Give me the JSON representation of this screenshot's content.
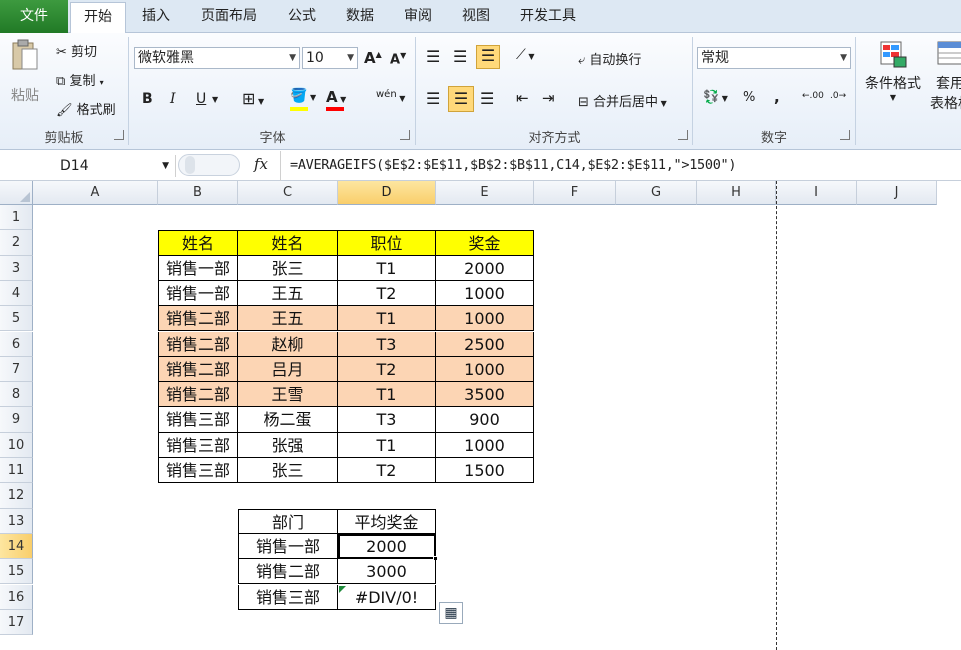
{
  "tabs": [
    "文件",
    "开始",
    "插入",
    "页面布局",
    "公式",
    "数据",
    "审阅",
    "视图",
    "开发工具"
  ],
  "ribbon": {
    "clipboard": {
      "paste": "粘贴",
      "cut": "剪切",
      "copy": "复制",
      "format_painter": "格式刷",
      "label": "剪贴板"
    },
    "font": {
      "name": "微软雅黑",
      "size": "10",
      "label": "字体",
      "bold": "B",
      "italic": "I",
      "underline": "U",
      "grow": "A",
      "shrink": "A",
      "fill_color": "#ffff00",
      "font_color": "#ff0000",
      "phonetic": "wén"
    },
    "align": {
      "wrap": "自动换行",
      "merge": "合并后居中",
      "label": "对齐方式"
    },
    "number": {
      "format": "常规",
      "label": "数字",
      "percent": "%",
      "comma": ",",
      "inc": ".00",
      "dec": ".0"
    },
    "styles": {
      "cond": "条件格式",
      "table": "套用",
      "table2": "表格格"
    }
  },
  "formula_bar": {
    "name_box": "D14",
    "fx": "fx",
    "formula": "=AVERAGEIFS($E$2:$E$11,$B$2:$B$11,C14,$E$2:$E$11,\">1500\")"
  },
  "columns": [
    "A",
    "B",
    "C",
    "D",
    "E",
    "F",
    "G",
    "H",
    "I",
    "J"
  ],
  "rows": [
    "1",
    "2",
    "3",
    "4",
    "5",
    "6",
    "7",
    "8",
    "9",
    "10",
    "11",
    "12",
    "13",
    "14",
    "15",
    "16",
    "17"
  ],
  "selected": {
    "col": "D",
    "row": "14"
  },
  "table1": {
    "header": [
      "姓名",
      "姓名",
      "职位",
      "奖金"
    ],
    "rows": [
      [
        "销售一部",
        "张三",
        "T1",
        "2000"
      ],
      [
        "销售一部",
        "王五",
        "T2",
        "1000"
      ],
      [
        "销售二部",
        "王五",
        "T1",
        "1000"
      ],
      [
        "销售二部",
        "赵柳",
        "T3",
        "2500"
      ],
      [
        "销售二部",
        "吕月",
        "T2",
        "1000"
      ],
      [
        "销售二部",
        "王雪",
        "T1",
        "3500"
      ],
      [
        "销售三部",
        "杨二蛋",
        "T3",
        "900"
      ],
      [
        "销售三部",
        "张强",
        "T1",
        "1000"
      ],
      [
        "销售三部",
        "张三",
        "T2",
        "1500"
      ]
    ],
    "header_color": "#ffff00",
    "highlight_color": "#fcd5b4"
  },
  "table2": {
    "header": [
      "部门",
      "平均奖金"
    ],
    "rows": [
      [
        "销售一部",
        "2000"
      ],
      [
        "销售二部",
        "3000"
      ],
      [
        "销售三部",
        "#DIV/0!"
      ]
    ]
  }
}
